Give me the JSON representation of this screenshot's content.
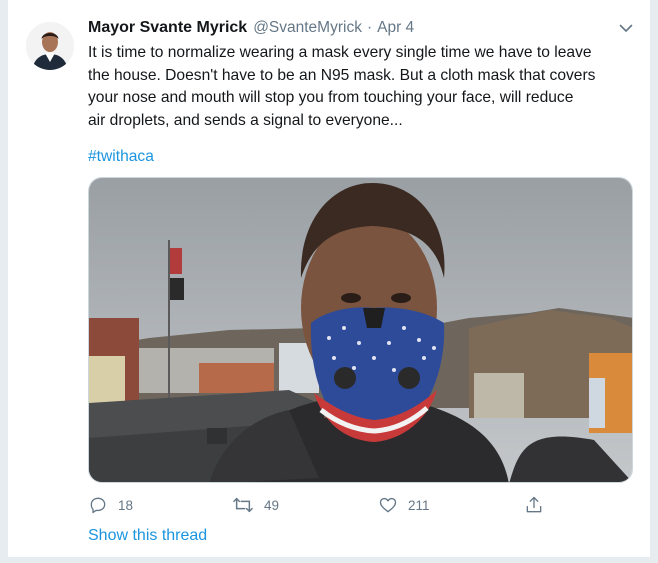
{
  "tweet": {
    "author_name": "Mayor Svante Myrick",
    "handle": "@SvanteMyrick",
    "separator": "·",
    "date": "Apr 4",
    "text": "It is time to normalize wearing a mask every single time we have to leave\nthe house. Doesn't have to be an N95 mask. But a cloth mask that covers\nyour nose and mouth will stop you from touching your face, will reduce\nair droplets, and sends a signal to everyone...",
    "hashtag": "#twithaca"
  },
  "actions": {
    "replies": "18",
    "retweets": "49",
    "likes": "211"
  },
  "show_thread_label": "Show this thread",
  "icons": [
    "chevron-down-icon",
    "reply-icon",
    "retweet-icon",
    "like-icon",
    "share-icon"
  ],
  "colors": {
    "link": "#1b95e0",
    "secondary_text": "#657786",
    "primary_text": "#14171a",
    "background": "#e6ecf0"
  }
}
